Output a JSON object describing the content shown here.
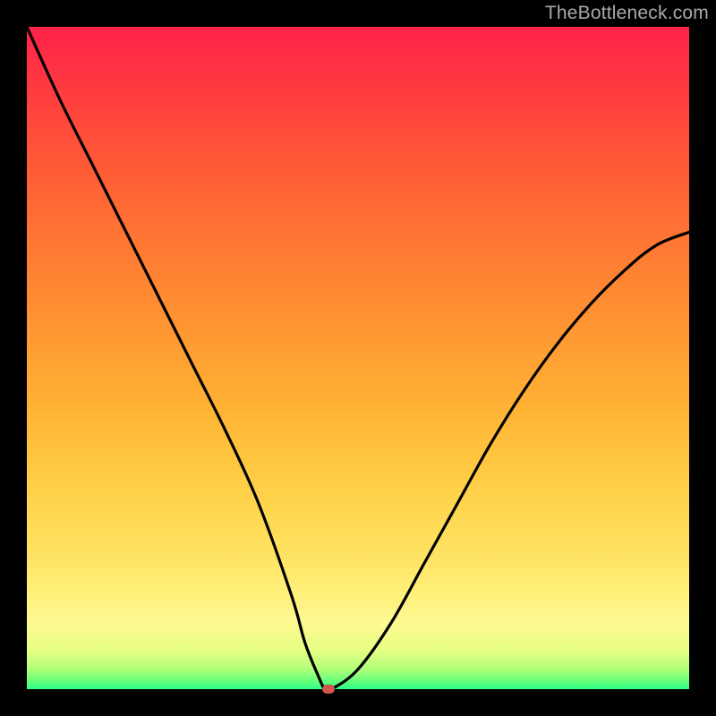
{
  "branding": {
    "text": "TheBottleneck.com"
  },
  "colors": {
    "curve_stroke": "#000000",
    "marker_fill": "#d2564d",
    "background": "#000000"
  },
  "chart_data": {
    "type": "line",
    "title": "",
    "xlabel": "",
    "ylabel": "",
    "xlim": [
      0,
      100
    ],
    "ylim": [
      0,
      100
    ],
    "x": [
      0,
      5,
      10,
      15,
      20,
      25,
      30,
      35,
      40,
      42,
      44,
      45,
      46,
      50,
      55,
      60,
      65,
      70,
      75,
      80,
      85,
      90,
      95,
      100
    ],
    "values": [
      100,
      89,
      79,
      69,
      59,
      49,
      39,
      28,
      14,
      7,
      2,
      0,
      0,
      3,
      10,
      19,
      28,
      37,
      45,
      52,
      58,
      63,
      67,
      69
    ],
    "marker": {
      "x": 45.5,
      "y": 0
    },
    "grid": false,
    "legend": false
  }
}
